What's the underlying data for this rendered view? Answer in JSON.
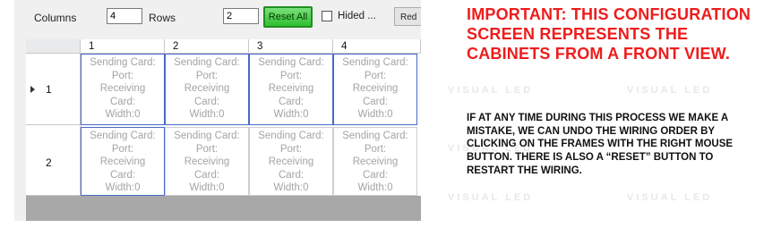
{
  "toolbar": {
    "columns_label": "Columns",
    "columns_value": "4",
    "rows_label": "Rows",
    "rows_value": "2",
    "reset_label": "Reset All",
    "hided_label": "Hided ...",
    "red_label": "Red"
  },
  "grid": {
    "columns": [
      "1",
      "2",
      "3",
      "4"
    ],
    "rows": [
      "1",
      "2"
    ],
    "cell_lines": [
      "Sending Card:",
      "Port:",
      "Receiving",
      "Card:",
      "Width:0"
    ]
  },
  "info": {
    "title": "IMPORTANT: THIS CONFIGURATION SCREEN REPRESENTS THE CABINETS FROM A FRONT VIEW.",
    "body": "IF AT ANY TIME DURING THIS PROCESS WE MAKE A MISTAKE, WE CAN UNDO THE WIRING ORDER BY CLICKING ON THE FRAMES WITH THE RIGHT MOUSE BUTTON. THERE IS ALSO A “RESET” BUTTON TO RESTART THE WIRING."
  },
  "watermark": "VISUAL LED",
  "colors": {
    "title_red": "#ee1c1c",
    "reset_green": "#2fbf2f",
    "cell_border_blue": "#4a68c8"
  }
}
